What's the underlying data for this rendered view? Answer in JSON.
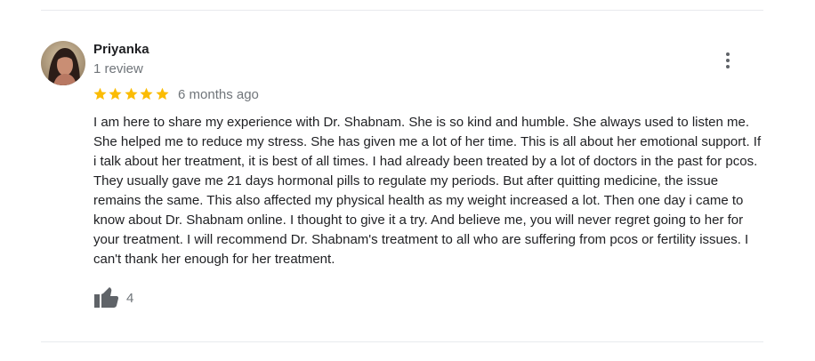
{
  "review": {
    "reviewer_name": "Priyanka",
    "review_count": "1 review",
    "rating": 5,
    "max_rating": 5,
    "time_ago": "6 months ago",
    "text": "I am here to share my experience with Dr. Shabnam. She is so kind and humble. She always used to listen me. She helped me to reduce my stress. She has given me a lot of her time. This is all about her emotional support. If i talk about her treatment, it is best of all times. I had already been treated by a lot of doctors in the past for pcos. They usually gave me 21 days hormonal pills to regulate my periods. But after quitting medicine, the issue remains the same. This also affected my physical health as my weight increased a lot. Then one day i came to know about Dr. Shabnam online. I thought to give it a try. And believe me, you will never regret going to her for your treatment. I will recommend Dr. Shabnam's treatment to all who are suffering from pcos or fertility issues. I can't thank her enough for her treatment.",
    "like_count": "4"
  },
  "icons": {
    "star": "star-icon",
    "more": "more-vert-icon",
    "like": "thumb-up-icon"
  },
  "colors": {
    "star": "#fbbc04",
    "secondary_text": "#70757a",
    "icon": "#5f6368",
    "divider": "#e8eaed"
  }
}
